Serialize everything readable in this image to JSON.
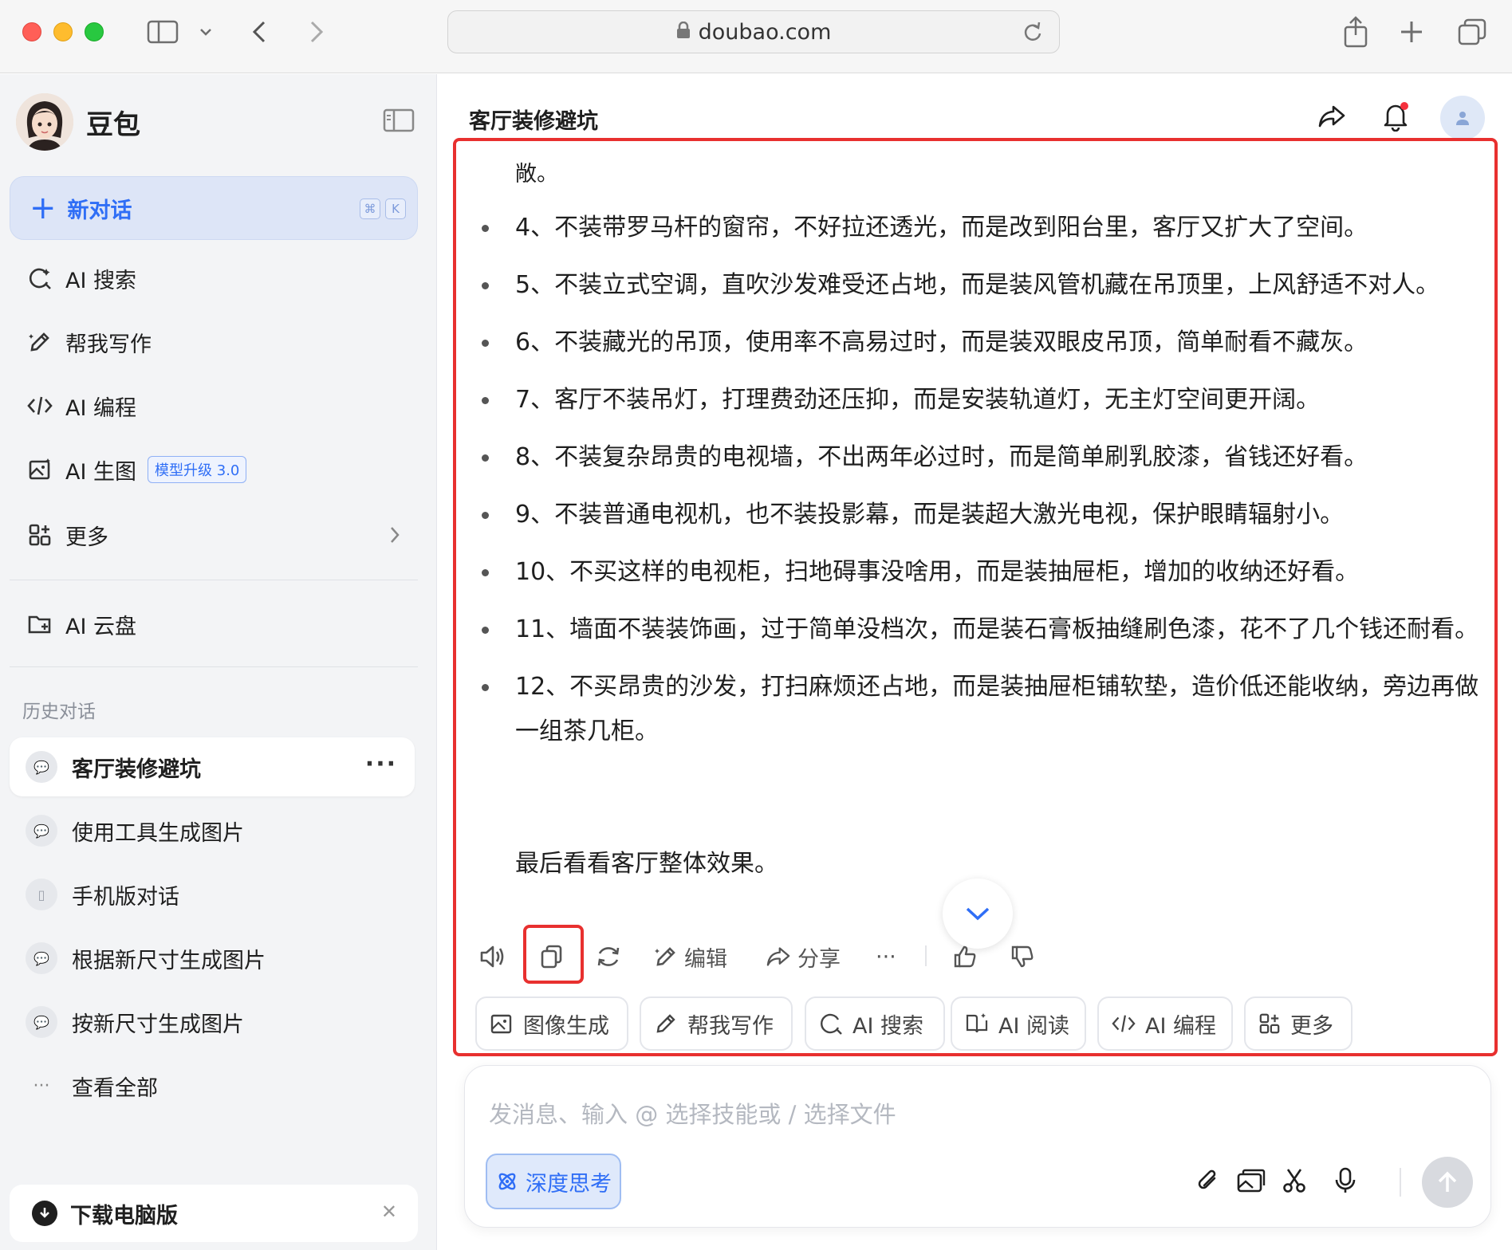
{
  "browser": {
    "url": "doubao.com"
  },
  "sidebar": {
    "brand": "豆包",
    "new_chat": {
      "label": "新对话",
      "shortcut_cmd": "⌘",
      "shortcut_key": "K"
    },
    "nav_items": [
      {
        "label": "AI 搜索",
        "icon": "search-icon"
      },
      {
        "label": "帮我写作",
        "icon": "pen-icon"
      },
      {
        "label": "AI 编程",
        "icon": "code-icon"
      },
      {
        "label": "AI 生图",
        "icon": "image-icon",
        "badge": "模型升级 3.0"
      },
      {
        "label": "更多",
        "icon": "apps-icon"
      },
      {
        "label": "AI 云盘",
        "icon": "cloud-folder-icon"
      }
    ],
    "history_title": "历史对话",
    "history": [
      {
        "label": "客厅装修避坑",
        "active": true
      },
      {
        "label": "使用工具生成图片"
      },
      {
        "label": "手机版对话"
      },
      {
        "label": "根据新尺寸生成图片"
      },
      {
        "label": "按新尺寸生成图片"
      },
      {
        "label": "查看全部"
      }
    ],
    "download_label": "下载电脑版"
  },
  "main": {
    "title": "客厅装修避坑",
    "continuation": "敞。",
    "items": [
      "4、不装带罗马杆的窗帘，不好拉还透光，而是改到阳台里，客厅又扩大了空间。",
      "5、不装立式空调，直吹沙发难受还占地，而是装风管机藏在吊顶里，上风舒适不对人。",
      "6、不装藏光的吊顶，使用率不高易过时，而是装双眼皮吊顶，简单耐看不藏灰。",
      "7、客厅不装吊灯，打理费劲还压抑，而是安装轨道灯，无主灯空间更开阔。",
      "8、不装复杂昂贵的电视墙，不出两年必过时，而是简单刷乳胶漆，省钱还好看。",
      "9、不装普通电视机，也不装投影幕，而是装超大激光电视，保护眼睛辐射小。",
      "10、不买这样的电视柜，扫地碍事没啥用，而是装抽屉柜，增加的收纳还好看。",
      "11、墙面不装装饰画，过于简单没档次，而是装石膏板抽缝刷色漆，花不了几个钱还耐看。",
      "12、不买昂贵的沙发，打扫麻烦还占地，而是装抽屉柜铺软垫，造价低还能收纳，旁边再做一组茶几柜。"
    ],
    "final_line": "最后看看客厅整体效果。",
    "actions": {
      "edit": "编辑",
      "share": "分享",
      "more": "···"
    },
    "chips": [
      {
        "label": "图像生成",
        "icon": "image-gen-icon"
      },
      {
        "label": "帮我写作",
        "icon": "pen-icon"
      },
      {
        "label": "AI 搜索",
        "icon": "search-icon"
      },
      {
        "label": "AI 阅读",
        "icon": "read-icon"
      },
      {
        "label": "AI 编程",
        "icon": "code-icon"
      },
      {
        "label": "更多",
        "icon": "apps-icon"
      }
    ],
    "composer": {
      "placeholder": "发消息、输入 @ 选择技能或 / 选择文件",
      "deep_think": "深度思考"
    }
  },
  "colors": {
    "accent": "#2f6ef6",
    "highlight": "#e8302f"
  }
}
